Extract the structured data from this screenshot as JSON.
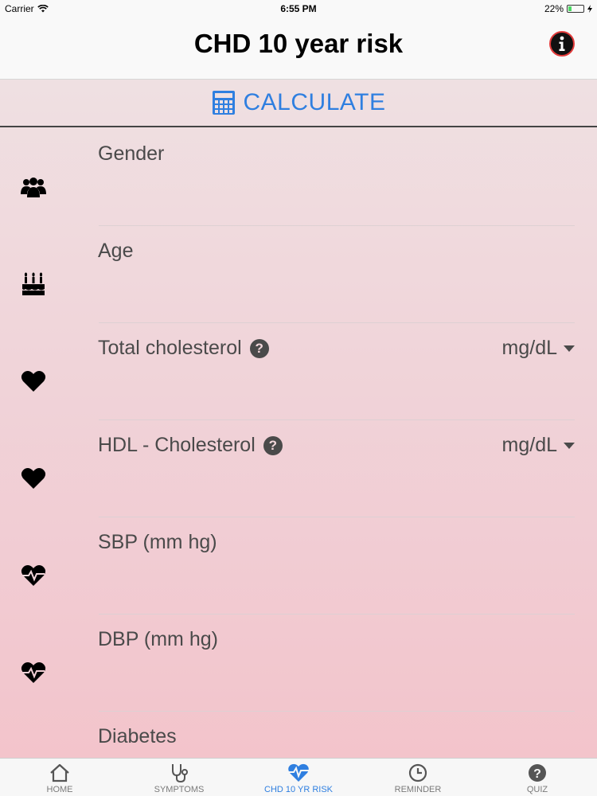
{
  "status_bar": {
    "carrier": "Carrier",
    "time": "6:55 PM",
    "battery": "22%",
    "battery_level": 0.22
  },
  "nav": {
    "title": "CHD 10 year risk"
  },
  "calculate": {
    "label": "CALCULATE"
  },
  "fields": [
    {
      "label": "Gender",
      "icon": "users-icon",
      "help": false,
      "unit": ""
    },
    {
      "label": "Age",
      "icon": "birthday-cake-icon",
      "help": false,
      "unit": ""
    },
    {
      "label": "Total cholesterol",
      "icon": "heart-icon",
      "help": true,
      "unit": "mg/dL"
    },
    {
      "label": "HDL - Cholesterol",
      "icon": "heart-icon",
      "help": true,
      "unit": "mg/dL"
    },
    {
      "label": "SBP (mm hg)",
      "icon": "heartbeat-icon",
      "help": false,
      "unit": ""
    },
    {
      "label": "DBP (mm hg)",
      "icon": "heartbeat-icon",
      "help": false,
      "unit": ""
    },
    {
      "label": "Diabetes",
      "icon": "",
      "help": false,
      "unit": ""
    }
  ],
  "tabs": [
    {
      "label": "HOME",
      "icon": "home-icon",
      "active": false
    },
    {
      "label": "SYMPTOMS",
      "icon": "stethoscope-icon",
      "active": false
    },
    {
      "label": "CHD 10 YR RISK",
      "icon": "heartbeat-icon",
      "active": true
    },
    {
      "label": "REMINDER",
      "icon": "clock-icon",
      "active": false
    },
    {
      "label": "QUIZ",
      "icon": "question-icon",
      "active": false
    }
  ],
  "colors": {
    "accent": "#2f7fe0",
    "text": "#4a4a4a",
    "info_ring": "#e23b3b"
  }
}
